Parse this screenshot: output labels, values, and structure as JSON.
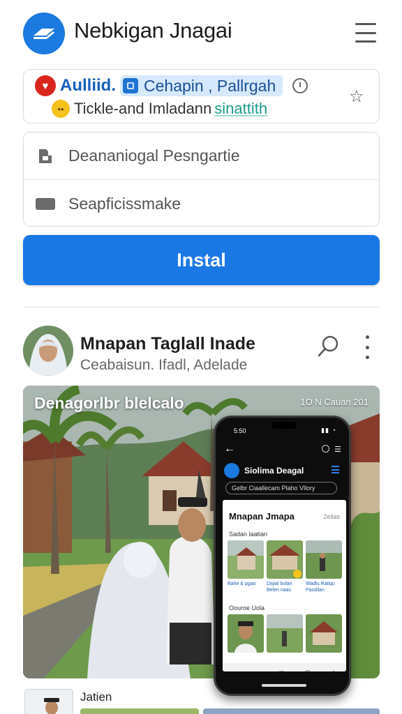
{
  "header": {
    "app_title": "Nebkigan Jnagai"
  },
  "notification": {
    "app_name": "Aulliid.",
    "chip_text": "Cehapin , Pallrgah",
    "message": "Tickle-and Imladann",
    "highlight": "sinattith"
  },
  "form": {
    "field1_text": "Deananiogal Pesngartie",
    "field2_text": "Seapficissmake",
    "install_label": "Instal"
  },
  "profile": {
    "name": "Mnapan Taglall Inade",
    "subtitle": "Ceabaisun. Ifadl, Adelade"
  },
  "media": {
    "caption": "Denagorlbr blelcalo",
    "stamp": "1O N Cauan 201"
  },
  "phone": {
    "status_time": "5:50",
    "app_name": "Siolima Deagal",
    "search_text": "Gelbr Ciaallecam Plaho Vllory",
    "screen_title": "Mnapan Jmapa",
    "screen_side": "2eilas",
    "section1": "Sadan laatian",
    "section2": "Oouroe Uola",
    "thumb_caps": [
      "Bahe & pgao",
      "Dajial bulan Belen naas",
      "Wadlu Ratiqu Pasdilan"
    ]
  },
  "bottom": {
    "label": "Jatien"
  },
  "colors": {
    "accent": "#1a78e5",
    "brand_logo": "#1a7ae0",
    "badge_red": "#d9261c",
    "highlight_teal": "#1a9c8a"
  }
}
